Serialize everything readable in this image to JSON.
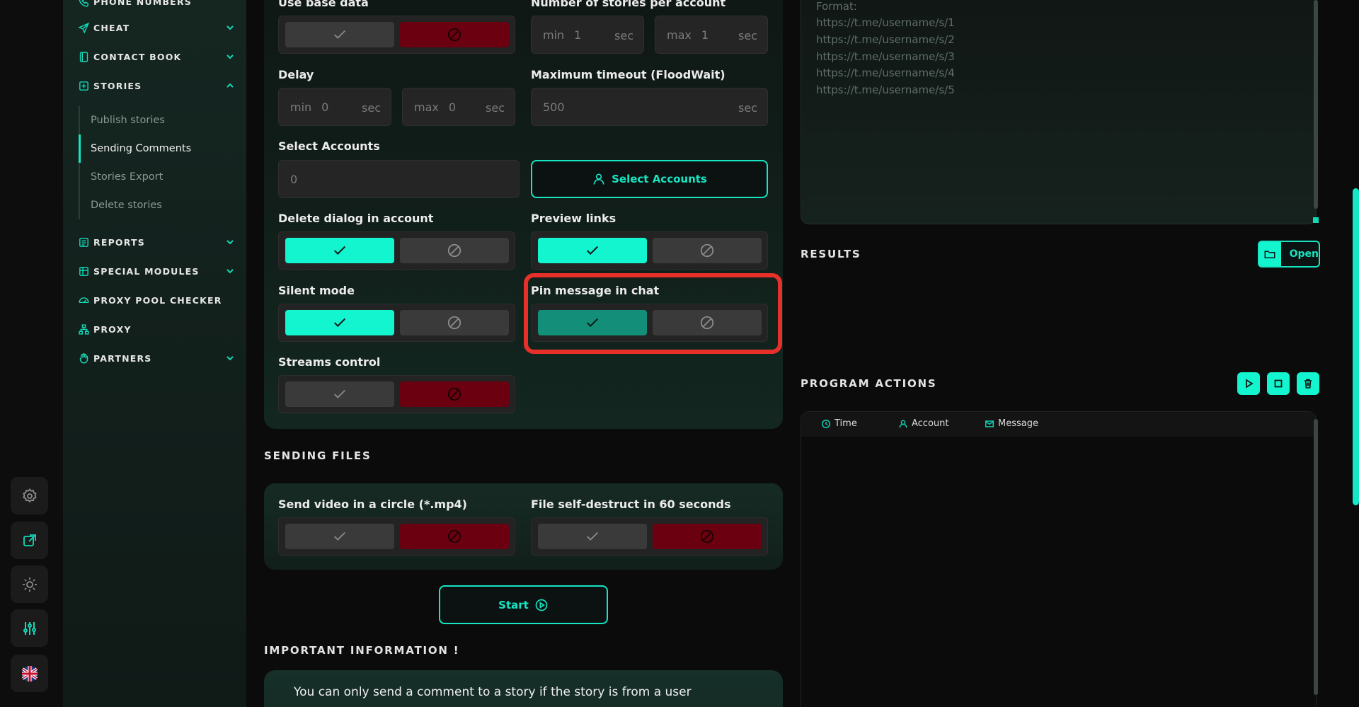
{
  "sidebar": {
    "items": [
      {
        "label": "PHONE NUMBERS"
      },
      {
        "label": "CHEAT"
      },
      {
        "label": "CONTACT BOOK"
      },
      {
        "label": "STORIES"
      },
      {
        "label": "REPORTS"
      },
      {
        "label": "SPECIAL MODULES"
      },
      {
        "label": "PROXY POOL CHECKER"
      },
      {
        "label": "PROXY"
      },
      {
        "label": "PARTNERS"
      }
    ],
    "sub_items": [
      "Publish stories",
      "Sending Comments",
      "Stories Export",
      "Delete stories"
    ],
    "active_sub": "Sending Comments"
  },
  "settings": {
    "use_base_data": {
      "label": "Use base data",
      "value": "no"
    },
    "stories_per_account": {
      "label": "Number of stories per account",
      "min_label": "min",
      "min_value": "1",
      "max_label": "max",
      "max_value": "1",
      "unit": "sec"
    },
    "delay": {
      "label": "Delay",
      "min_label": "min",
      "min_value": "0",
      "max_label": "max",
      "max_value": "0",
      "unit": "sec"
    },
    "max_timeout": {
      "label": "Maximum timeout (FloodWait)",
      "value": "500",
      "unit": "sec"
    },
    "select_accounts": {
      "label": "Select Accounts",
      "count": "0",
      "button": "Select Accounts"
    },
    "delete_dialog": {
      "label": "Delete dialog in account",
      "value": "yes"
    },
    "preview_links": {
      "label": "Preview links",
      "value": "yes"
    },
    "silent_mode": {
      "label": "Silent mode",
      "value": "yes"
    },
    "pin_message": {
      "label": "Pin message in chat",
      "value": "yes"
    },
    "streams_control": {
      "label": "Streams control",
      "value": "no"
    }
  },
  "sending_files": {
    "title": "SENDING FILES",
    "video_circle": {
      "label": "Send video in a circle (*.mp4)",
      "value": "no"
    },
    "self_destruct": {
      "label": "File self-destruct in 60 seconds",
      "value": "no"
    }
  },
  "start_button": "Start",
  "important": {
    "title": "IMPORTANT INFORMATION !",
    "text": "You can only send a comment to a story if the story is from a user"
  },
  "links_input": {
    "lines": [
      "Format:",
      "https://t.me/username/s/1",
      "https://t.me/username/s/2",
      "https://t.me/username/s/3",
      "https://t.me/username/s/4",
      "https://t.me/username/s/5"
    ]
  },
  "results": {
    "title": "RESULTS",
    "open_label": "Open"
  },
  "program_actions": {
    "title": "PROGRAM ACTIONS",
    "columns": [
      "Time",
      "Account",
      "Message"
    ]
  },
  "colors": {
    "accent": "#13f5cf",
    "danger": "#6b0010",
    "highlight": "#e7302a"
  }
}
